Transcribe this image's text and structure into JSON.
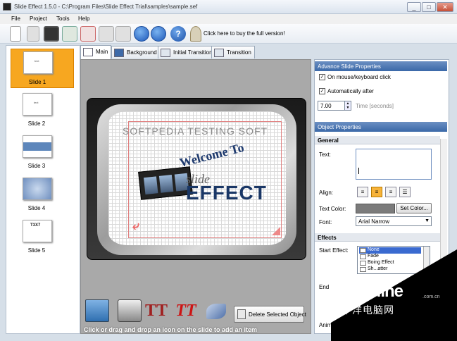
{
  "window": {
    "title": "Slide Effect 1.5.0 - C:\\Program Files\\Slide Effect Trial\\samples\\sample.sef",
    "minimize": "_",
    "maximize": "□",
    "close": "✕"
  },
  "menu": [
    "File",
    "Project",
    "Tools",
    "Help"
  ],
  "toolbar": {
    "help_glyph": "?",
    "buy_text": "Click here to buy the full version!"
  },
  "slides": [
    {
      "label": "Slide 1",
      "mini": "text"
    },
    {
      "label": "Slide 2",
      "mini": "text"
    },
    {
      "label": "Slide 3",
      "mini": ""
    },
    {
      "label": "Slide 4",
      "mini": ""
    },
    {
      "label": "Slide 5",
      "mini": "T3X7"
    }
  ],
  "tabs": [
    "Main",
    "Background",
    "Initial Transition",
    "Transition"
  ],
  "canvas": {
    "banner_text": "SOFTPEDIA TESTING SOFT",
    "welcome_text": "Welcome To",
    "slide_text": "slide",
    "effect_text": "EFFECT",
    "delete_button": "Delete Selected Object",
    "hint": "Click or drag and drop an icon on the slide to add an item",
    "tt_glyph": "TT"
  },
  "properties": {
    "advance_header": "Advance Slide Properties",
    "on_mouse_label": "On mouse/keyboard click",
    "auto_after_label": "Automatically after",
    "time_value": "7.00",
    "time_label": "Time [seconds]",
    "object_header": "Object Properties",
    "general_header": "General",
    "text_label": "Text:",
    "align_label": "Align:",
    "text_color_label": "Text Color:",
    "set_color_button": "Set Color...",
    "font_label": "Font:",
    "font_value": "Arial Narrow",
    "effects_header": "Effects",
    "start_effect_label": "Start Effect:",
    "effect_options": [
      "None",
      "Fade",
      "Boing Effect",
      "Sh...atter"
    ],
    "end_label": "End",
    "anim_label": "Anim"
  },
  "watermark": {
    "brand": "PConline",
    "domain": ".com.cn",
    "sub": "太平洋电脑网"
  }
}
